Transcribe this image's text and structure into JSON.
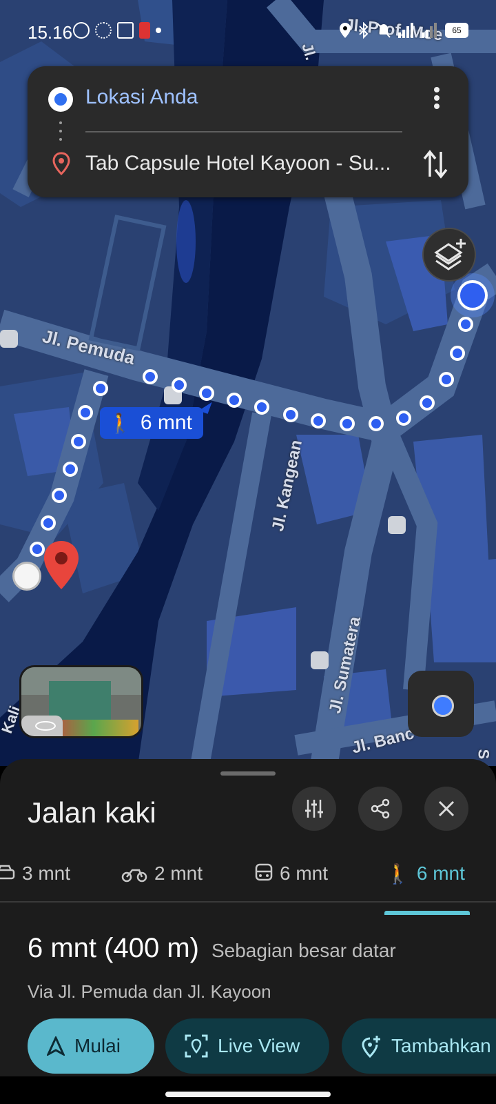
{
  "status_bar": {
    "time": "15.16",
    "battery": "65"
  },
  "route": {
    "origin": "Lokasi Anda",
    "destination": "Tab Capsule Hotel Kayoon - Su..."
  },
  "map": {
    "streets": [
      "Jl. Pemuda",
      "Jl. Kangean",
      "Jl. Sumatera",
      "Jl. Banc",
      "Jl. Prof. Moe",
      "Jl.",
      "Kali",
      "S"
    ],
    "walk_label": "6 mnt"
  },
  "sheet": {
    "title": "Jalan kaki",
    "tabs": [
      {
        "label": "3 mnt",
        "icon": "car-icon"
      },
      {
        "label": "2 mnt",
        "icon": "motorcycle-icon"
      },
      {
        "label": "6 mnt",
        "icon": "transit-icon"
      },
      {
        "label": "6 mnt",
        "icon": "walk-icon",
        "active": true
      }
    ],
    "duration": "6 mnt (400 m)",
    "terrain_note": "Sebagian besar datar",
    "via": "Via Jl. Pemuda dan Jl. Kayoon",
    "actions": {
      "start": "Mulai",
      "live_view": "Live View",
      "add_stop": "Tambahkan"
    }
  },
  "colors": {
    "accent": "#5ec7d8",
    "route_dot": "#2f5ff0",
    "map_base": "#28406e"
  }
}
